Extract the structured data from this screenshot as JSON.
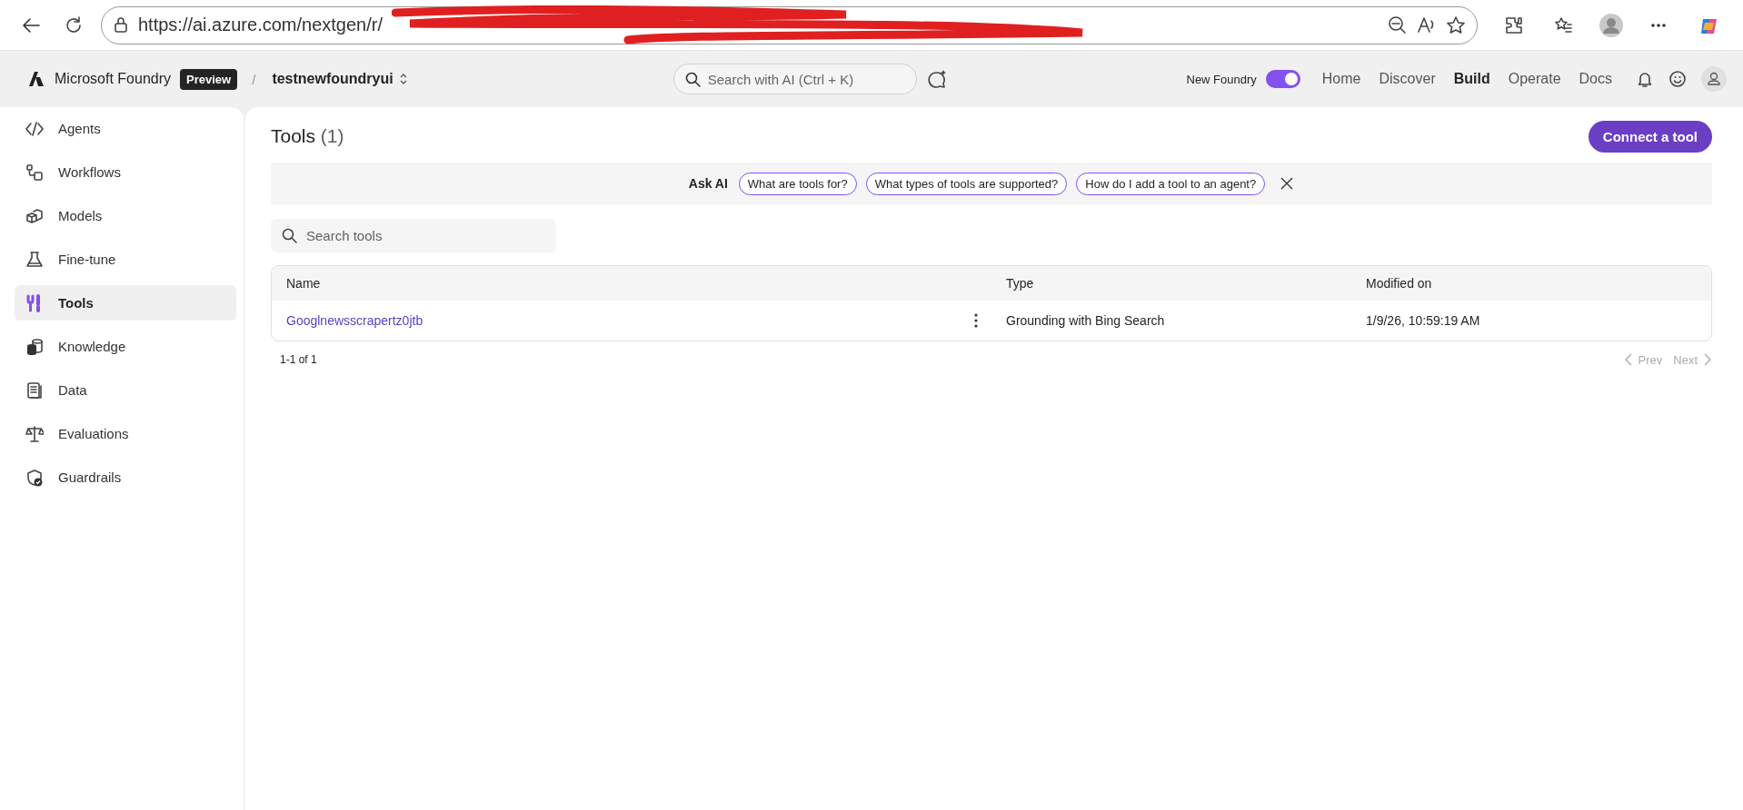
{
  "browser": {
    "url": "https://ai.azure.com/nextgen/r/"
  },
  "header": {
    "brand": "Microsoft Foundry",
    "badge": "Preview",
    "separator": "/",
    "project": "testnewfoundryui",
    "search": {
      "placeholder": "Search with AI (Ctrl + K)"
    },
    "toggle": {
      "label": "New Foundry",
      "on": true
    },
    "nav": [
      {
        "label": "Home",
        "selected": false
      },
      {
        "label": "Discover",
        "selected": false
      },
      {
        "label": "Build",
        "selected": true
      },
      {
        "label": "Operate",
        "selected": false
      },
      {
        "label": "Docs",
        "selected": false
      }
    ]
  },
  "sidebar": {
    "items": [
      {
        "label": "Agents",
        "selected": false
      },
      {
        "label": "Workflows",
        "selected": false
      },
      {
        "label": "Models",
        "selected": false
      },
      {
        "label": "Fine-tune",
        "selected": false
      },
      {
        "label": "Tools",
        "selected": true
      },
      {
        "label": "Knowledge",
        "selected": false
      },
      {
        "label": "Data",
        "selected": false
      },
      {
        "label": "Evaluations",
        "selected": false
      },
      {
        "label": "Guardrails",
        "selected": false
      }
    ]
  },
  "page": {
    "title": "Tools",
    "count": "(1)",
    "primary_button": "Connect a tool",
    "ask_ai": {
      "label": "Ask AI",
      "suggestions": [
        "What are tools for?",
        "What types of tools are supported?",
        "How do I add a tool to an agent?"
      ]
    },
    "search": {
      "placeholder": "Search tools"
    },
    "table": {
      "columns": [
        "Name",
        "Type",
        "Modified on"
      ],
      "rows": [
        {
          "name": "Googlnewsscrapertz0jtb",
          "type": "Grounding with Bing Search",
          "modified": "1/9/26, 10:59:19 AM"
        }
      ]
    },
    "pagination": {
      "summary": "1-1 of 1",
      "prev": {
        "label": "Prev",
        "disabled": true
      },
      "next": {
        "label": "Next",
        "disabled": true
      }
    }
  }
}
